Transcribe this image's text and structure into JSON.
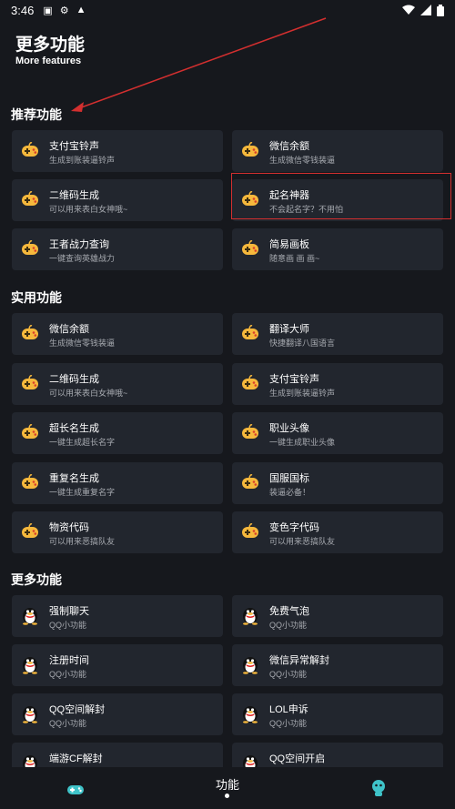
{
  "status_bar": {
    "time": "3:46"
  },
  "header": {
    "title": "更多功能",
    "subtitle": "More features"
  },
  "sections": [
    {
      "title": "推荐功能",
      "items": [
        {
          "title": "支付宝铃声",
          "desc": "生成到账装逼铃声",
          "icon": "gamepad-icon"
        },
        {
          "title": "微信余额",
          "desc": "生成微信零钱装逼",
          "icon": "gamepad-icon"
        },
        {
          "title": "二维码生成",
          "desc": "可以用来表白女神哦~",
          "icon": "gamepad-icon"
        },
        {
          "title": "起名神器",
          "desc": "不会起名字？不用怕",
          "icon": "gamepad-icon"
        },
        {
          "title": "王者战力查询",
          "desc": "一键查询英雄战力",
          "icon": "gamepad-icon"
        },
        {
          "title": "简易画板",
          "desc": "随意画 画 画~",
          "icon": "gamepad-icon"
        }
      ]
    },
    {
      "title": "实用功能",
      "items": [
        {
          "title": "微信余额",
          "desc": "生成微信零钱装逼",
          "icon": "gamepad-icon"
        },
        {
          "title": "翻译大师",
          "desc": "快捷翻译八国语言",
          "icon": "gamepad-icon"
        },
        {
          "title": "二维码生成",
          "desc": "可以用来表白女神哦~",
          "icon": "gamepad-icon"
        },
        {
          "title": "支付宝铃声",
          "desc": "生成到账装逼铃声",
          "icon": "gamepad-icon"
        },
        {
          "title": "超长名生成",
          "desc": "一键生成超长名字",
          "icon": "gamepad-icon"
        },
        {
          "title": "职业头像",
          "desc": "一键生成职业头像",
          "icon": "gamepad-icon"
        },
        {
          "title": "重复名生成",
          "desc": "一键生成重复名字",
          "icon": "gamepad-icon"
        },
        {
          "title": "国服国标",
          "desc": "装逼必备！",
          "icon": "gamepad-icon"
        },
        {
          "title": "物资代码",
          "desc": "可以用来恶搞队友",
          "icon": "gamepad-icon"
        },
        {
          "title": "变色字代码",
          "desc": "可以用来恶搞队友",
          "icon": "gamepad-icon"
        }
      ]
    },
    {
      "title": "更多功能",
      "items": [
        {
          "title": "强制聊天",
          "desc": "QQ小功能",
          "icon": "qq-penguin-icon"
        },
        {
          "title": "免费气泡",
          "desc": "QQ小功能",
          "icon": "qq-penguin-icon"
        },
        {
          "title": "注册时间",
          "desc": "QQ小功能",
          "icon": "qq-penguin-icon"
        },
        {
          "title": "微信异常解封",
          "desc": "QQ小功能",
          "icon": "qq-penguin-icon"
        },
        {
          "title": "QQ空间解封",
          "desc": "QQ小功能",
          "icon": "qq-penguin-icon"
        },
        {
          "title": "LOL申诉",
          "desc": "QQ小功能",
          "icon": "qq-penguin-icon"
        },
        {
          "title": "端游CF解封",
          "desc": "",
          "icon": "qq-penguin-icon"
        },
        {
          "title": "QQ空间开启",
          "desc": "",
          "icon": "qq-penguin-icon"
        }
      ]
    }
  ],
  "bottom_nav": {
    "center_label": "功能",
    "left_icon": "gamepad-nav-icon",
    "right_icon": "robot-nav-icon"
  },
  "colors": {
    "background": "#16181d",
    "card": "#22262e",
    "highlight": "#d32f2f",
    "desc_text": "#a7aab0"
  }
}
